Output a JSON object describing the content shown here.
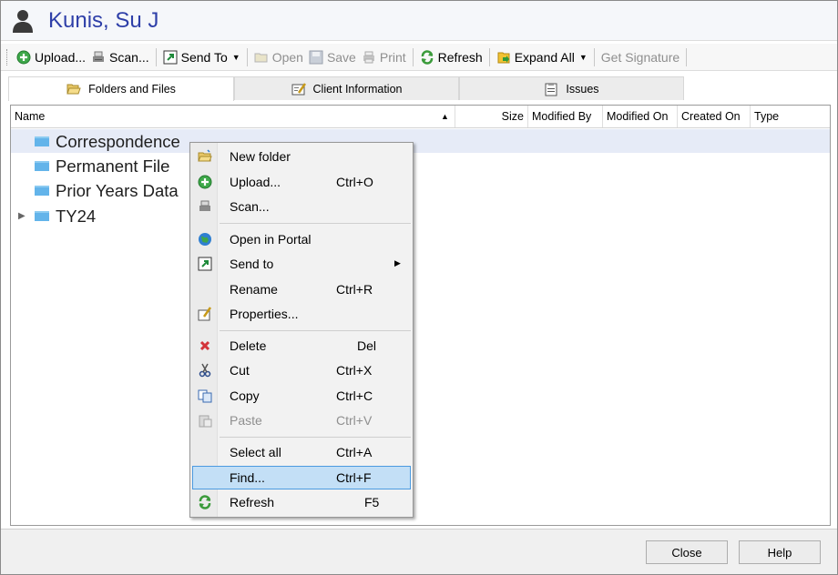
{
  "window": {
    "title": "Kunis, Su J"
  },
  "toolbar": {
    "upload": "Upload...",
    "scan": "Scan...",
    "send_to": "Send To",
    "open": "Open",
    "save": "Save",
    "print": "Print",
    "refresh": "Refresh",
    "expand_all": "Expand All",
    "get_signature": "Get Signature"
  },
  "tabs": [
    {
      "label": "Folders and Files",
      "icon": "folder-open-icon",
      "active": true
    },
    {
      "label": "Client Information",
      "icon": "client-info-icon",
      "active": false
    },
    {
      "label": "Issues",
      "icon": "issues-icon",
      "active": false
    }
  ],
  "grid": {
    "columns": [
      "Name",
      "Size",
      "Modified By",
      "Modified On",
      "Created On",
      "Type"
    ],
    "sorted_column": "Name",
    "rows": [
      {
        "name": "Correspondence",
        "expandable": false,
        "selected": true
      },
      {
        "name": "Permanent File",
        "expandable": false,
        "selected": false
      },
      {
        "name": "Prior Years Data",
        "expandable": false,
        "selected": false
      },
      {
        "name": "TY24",
        "expandable": true,
        "selected": false
      }
    ]
  },
  "context_menu": {
    "items": [
      {
        "label": "New folder",
        "shortcut": "",
        "icon": "new-folder-icon",
        "enabled": true
      },
      {
        "label": "Upload...",
        "shortcut": "Ctrl+O",
        "icon": "upload-icon",
        "enabled": true
      },
      {
        "label": "Scan...",
        "shortcut": "",
        "icon": "scanner-icon",
        "enabled": true
      },
      {
        "label": "Open in Portal",
        "shortcut": "",
        "icon": "globe-icon",
        "enabled": true
      },
      {
        "label": "Send to",
        "shortcut": "",
        "icon": "send-to-icon",
        "enabled": true,
        "submenu": true
      },
      {
        "label": "Rename",
        "shortcut": "Ctrl+R",
        "icon": "",
        "enabled": true
      },
      {
        "label": "Properties...",
        "shortcut": "",
        "icon": "properties-icon",
        "enabled": true
      },
      {
        "label": "Delete",
        "shortcut": "Del",
        "icon": "delete-icon",
        "enabled": true
      },
      {
        "label": "Cut",
        "shortcut": "Ctrl+X",
        "icon": "scissors-icon",
        "enabled": true
      },
      {
        "label": "Copy",
        "shortcut": "Ctrl+C",
        "icon": "copy-icon",
        "enabled": true
      },
      {
        "label": "Paste",
        "shortcut": "Ctrl+V",
        "icon": "paste-icon",
        "enabled": false
      },
      {
        "label": "Select all",
        "shortcut": "Ctrl+A",
        "icon": "",
        "enabled": true
      },
      {
        "label": "Find...",
        "shortcut": "Ctrl+F",
        "icon": "",
        "enabled": true,
        "highlighted": true
      },
      {
        "label": "Refresh",
        "shortcut": "F5",
        "icon": "refresh-icon",
        "enabled": true
      }
    ]
  },
  "footer": {
    "close": "Close",
    "help": "Help"
  },
  "colors": {
    "title": "#2e3fa8",
    "folder": "#63b4ea",
    "selection": "#e6ebf7",
    "menu_highlight": "#c3dff6"
  }
}
